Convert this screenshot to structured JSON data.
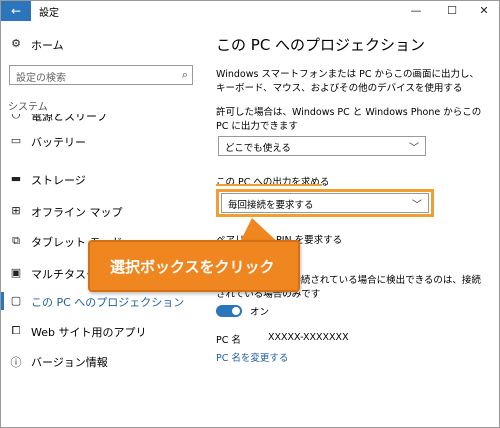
{
  "window": {
    "title": "設定",
    "back_icon": "←",
    "minimize_icon": "—",
    "maximize_icon": "☐",
    "close_icon": "✕"
  },
  "sidebar": {
    "home_label": "ホーム",
    "search_placeholder": "設定の検索",
    "section_header": "システム",
    "items": [
      {
        "label": "電源とスリープ",
        "icon": "power-icon",
        "glyph": "⏻"
      },
      {
        "label": "バッテリー",
        "icon": "battery-icon",
        "glyph": "▭"
      },
      {
        "label": "ストレージ",
        "icon": "storage-icon",
        "glyph": "▬"
      },
      {
        "label": "オフライン マップ",
        "icon": "map-icon",
        "glyph": "⊞"
      },
      {
        "label": "タブレット モード",
        "icon": "tablet-mode-icon",
        "glyph": "⧉"
      },
      {
        "label": "マルチタスク",
        "icon": "multitask-icon",
        "glyph": "▣"
      },
      {
        "label": "この PC へのプロジェクション",
        "icon": "projection-icon",
        "glyph": "▢"
      },
      {
        "label": "Web サイト用のアプリ",
        "icon": "web-apps-icon",
        "glyph": "⧠"
      },
      {
        "label": "バージョン情報",
        "icon": "info-icon",
        "glyph": "ⓘ"
      }
    ],
    "selected_index": 6
  },
  "main": {
    "title": "この PC へのプロジェクション",
    "description": "Windows スマートフォンまたは PC からこの画面に出力し、キーボード、マウス、およびその他のデバイスを使用する",
    "allow_text": "許可した場合は、Windows PC と Windows Phone からこの PC に出力できます",
    "allow_dropdown_value": "どこでも使える",
    "request_label": "この PC への出力を求める",
    "request_dropdown_value": "毎回接続を要求する",
    "pin_text": "ペアリングに PIN を要求する",
    "power_text": "この PC は電源に接続されている場合に検出できるのは、接続されている場合のみです",
    "toggle_label": "オン",
    "toggle_on": true,
    "pc_name_label": "PC 名",
    "pc_name_value": "XXXXX-XXXXXXX",
    "rename_link": "PC 名を変更する"
  },
  "callout": {
    "text": "選択ボックスをクリック",
    "color": "#f0861f"
  },
  "colors": {
    "accent": "#2b75bd",
    "highlight": "#f0a030"
  }
}
